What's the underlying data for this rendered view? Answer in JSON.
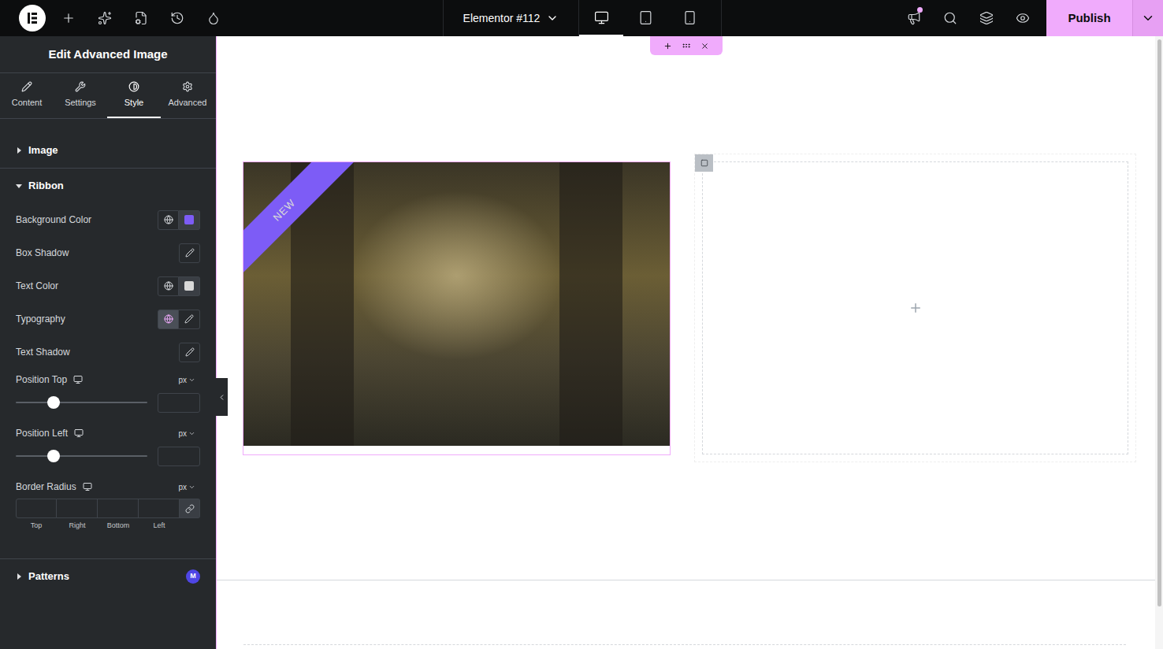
{
  "topbar": {
    "title": "Elementor #112",
    "devices": [
      {
        "name": "desktop",
        "selected": true
      },
      {
        "name": "tablet",
        "selected": false
      },
      {
        "name": "mobile",
        "selected": false
      }
    ],
    "notification": true,
    "publish": "Publish"
  },
  "panel": {
    "title": "Edit Advanced Image",
    "tabs": [
      {
        "label": "Content",
        "icon": "pencil",
        "selected": false
      },
      {
        "label": "Settings",
        "icon": "wrench",
        "selected": false
      },
      {
        "label": "Style",
        "icon": "contrast",
        "selected": true
      },
      {
        "label": "Advanced",
        "icon": "gear",
        "selected": false
      }
    ],
    "sections": [
      {
        "label": "Image",
        "expanded": false,
        "controls": []
      },
      {
        "label": "Ribbon",
        "expanded": true,
        "controls": [
          {
            "kind": "color",
            "label": "Background Color",
            "global_active": false,
            "color": "#7d5cf6"
          },
          {
            "kind": "popover",
            "label": "Box Shadow",
            "global": false,
            "global_active": false
          },
          {
            "kind": "color",
            "label": "Text Color",
            "global_active": false,
            "color": "#d9d9d9"
          },
          {
            "kind": "popover",
            "label": "Typography",
            "global": true,
            "global_active": true
          },
          {
            "kind": "popover",
            "label": "Text Shadow",
            "global": false,
            "global_active": false
          },
          {
            "kind": "slider",
            "label": "Position Top",
            "unit": "px",
            "level": 0.29,
            "value": ""
          },
          {
            "kind": "slider",
            "label": "Position Left",
            "unit": "px",
            "level": 0.29,
            "value": ""
          },
          {
            "kind": "dimensions",
            "label": "Border Radius",
            "unit": "px",
            "sides": [
              "Top",
              "Right",
              "Bottom",
              "Left"
            ],
            "linked": true
          }
        ]
      },
      {
        "label": "Patterns",
        "expanded": false,
        "badge": "M",
        "controls": []
      }
    ]
  },
  "canvas": {
    "widget_selected": true,
    "ribbon": "NEW",
    "empty_column": true
  }
}
